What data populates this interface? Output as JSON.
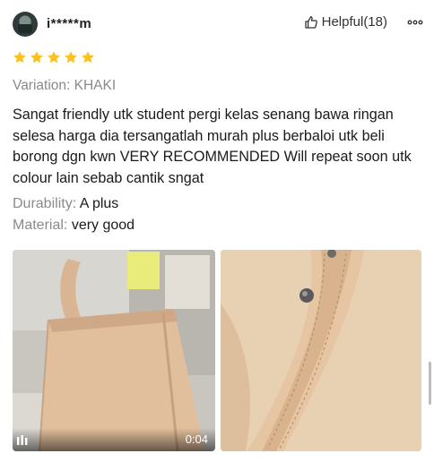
{
  "review": {
    "username": "i*****m",
    "helpful_label": "Helpful(18)",
    "rating": 5,
    "variation": "Variation: KHAKI",
    "text": "Sangat friendly utk student pergi kelas senang bawa ringan selesa harga dia tersangatlah murah plus berbaloi utk beli borong dgn kwn VERY RECOMMENDED Will repeat soon utk colour lain sebab cantik sngat",
    "attributes": [
      {
        "key": "Durability:",
        "value": "A plus"
      },
      {
        "key": "Material:",
        "value": "very good"
      }
    ],
    "media": [
      {
        "type": "video",
        "duration": "0:04"
      },
      {
        "type": "image"
      }
    ]
  },
  "colors": {
    "star": "#fcc121",
    "muted_text": "#8a8a8a"
  },
  "icons": {
    "helpful": "thumbs-up-outline-icon",
    "more": "more-options-icon",
    "video": "play-bars-icon"
  }
}
